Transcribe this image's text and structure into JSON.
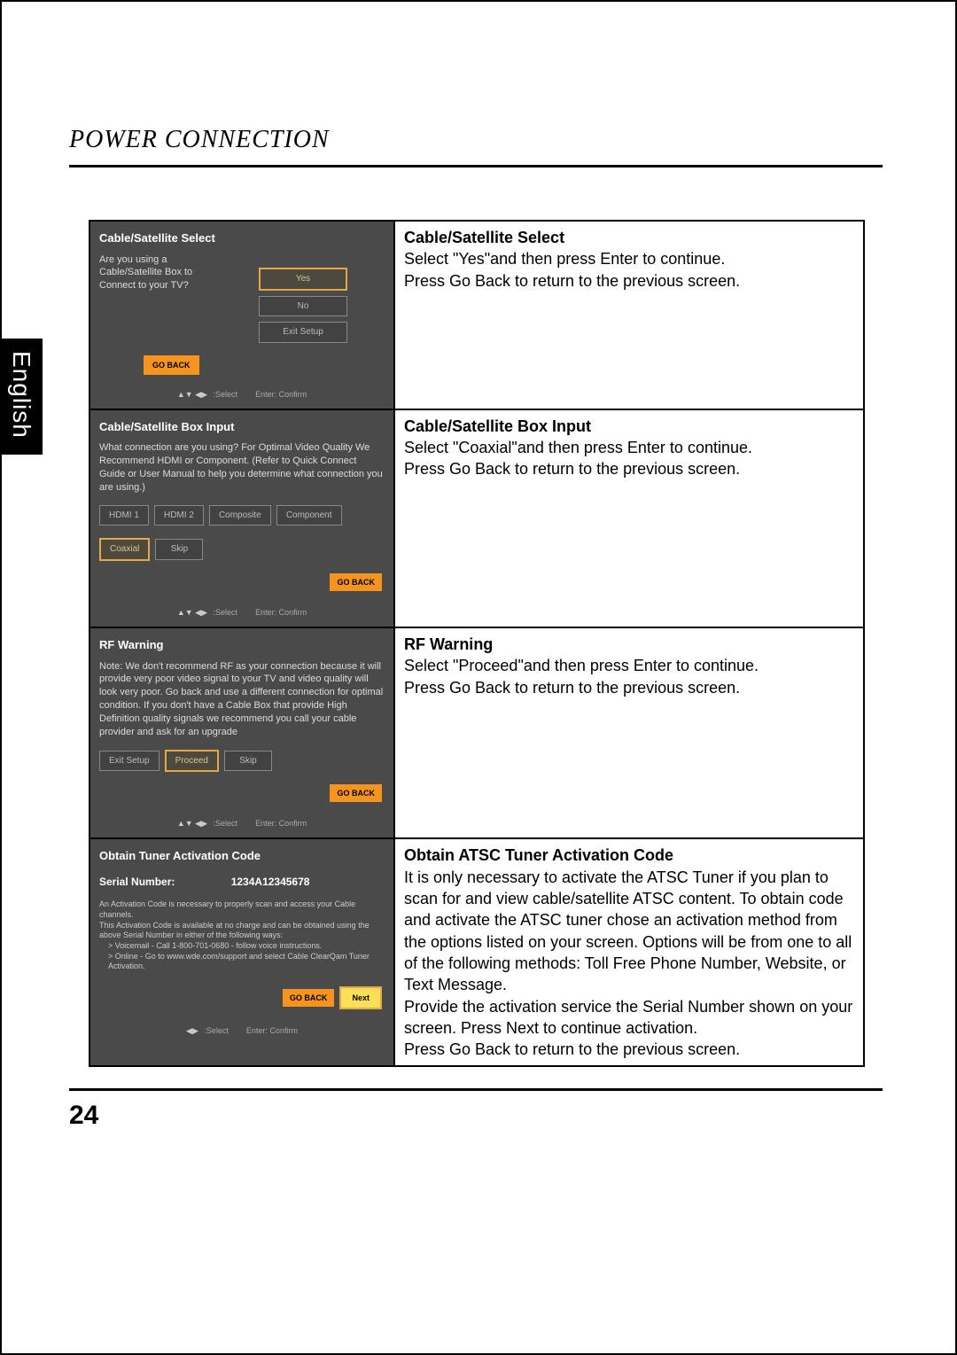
{
  "section_title": "POWER CONNECTION",
  "side_tab": "English",
  "page_number": "24",
  "nav_hint_select": ":Select",
  "nav_hint_confirm": "Enter: Confirm",
  "nav_hint_select_lr": ":Select",
  "go_back_label": "GO BACK",
  "next_label": "Next",
  "rows": [
    {
      "shot_title": "Cable/Satellite Select",
      "shot_body": "Are you using a Cable/Satellite Box to Connect to your TV?",
      "buttons": [
        "Yes",
        "No",
        "Exit Setup"
      ],
      "selected": "Yes",
      "instr_title": "Cable/Satellite Select",
      "instr_body": "Select \"Yes\"and then press Enter to continue.\nPress Go Back to return to the previous screen."
    },
    {
      "shot_title": "Cable/Satellite Box Input",
      "shot_body": "What connection are you using? For Optimal Video Quality We Recommend HDMI or Component. (Refer to Quick Connect Guide or User Manual to help you determine what connection you are using.)",
      "buttons": [
        "HDMI 1",
        "HDMI 2",
        "Composite",
        "Component",
        "Coaxial",
        "Skip"
      ],
      "selected": "Coaxial",
      "instr_title": "Cable/Satellite Box Input",
      "instr_body": "Select \"Coaxial\"and then press Enter to continue.\nPress Go Back to return to the previous screen."
    },
    {
      "shot_title": "RF Warning",
      "shot_body": "Note: We don't recommend RF as your connection because it will provide very poor video signal to your TV and video quality will look very poor. Go back and use a different connection for optimal condition. If you don't have a Cable Box that provide High Definition quality signals we recommend you call your cable provider and ask for an upgrade",
      "buttons": [
        "Exit Setup",
        "Proceed",
        "Skip"
      ],
      "selected": "Proceed",
      "instr_title": "RF Warning",
      "instr_body": "Select \"Proceed\"and then press Enter to continue.\nPress Go Back to return to the previous screen."
    },
    {
      "shot_title": "Obtain Tuner Activation Code",
      "serial_label": "Serial Number:",
      "serial_value": "1234A12345678",
      "tiny1": "An Activation Code is necessary to properly scan and access your Cable channels.",
      "tiny2": "This Activation Code is available at no charge and can be obtained using the above Serial Number in either of the following ways:",
      "tiny3": "> Voicemail - Call 1-800-701-0680 - follow voice instructions.",
      "tiny4": "> Online - Go to www.wde.com/support and select Cable ClearQam Tuner Activation.",
      "instr_title": "Obtain ATSC Tuner Activation Code",
      "instr_body": "It is only necessary to activate the ATSC Tuner if you plan to scan for and view cable/satellite ATSC content. To obtain code and activate the ATSC tuner chose an activation method from the options listed on your screen. Options will be from one to all of the following methods: Toll Free Phone Number, Website, or Text Message.\nProvide the activation service the Serial Number shown on your screen. Press Next to continue activation.\nPress Go Back to return to the previous screen."
    }
  ]
}
